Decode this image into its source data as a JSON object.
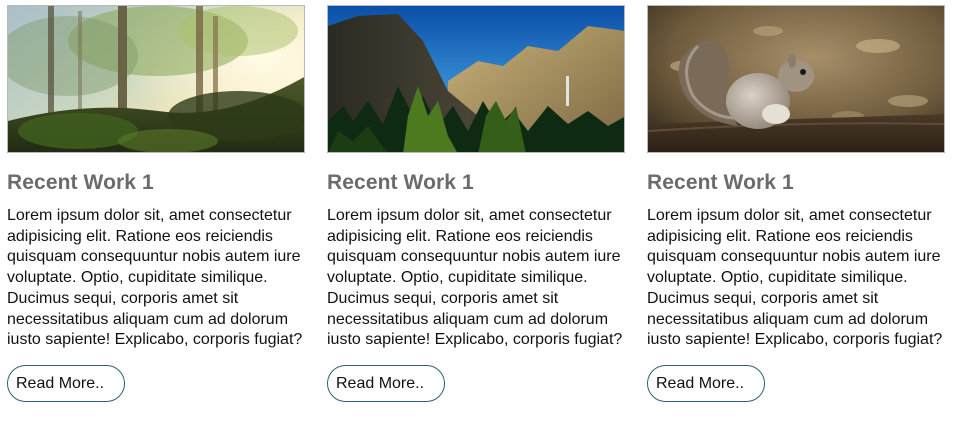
{
  "cards": [
    {
      "image": "forest-with-sunlight-image",
      "title": "Recent Work 1",
      "description": "Lorem ipsum dolor sit, amet consectetur adipisicing elit. Ratione eos reiciendis quisquam consequuntur nobis autem iure voluptate. Optio, cupiditate similique. Ducimus sequi, corporis amet sit necessitatibus aliquam cum ad dolorum iusto sapiente! Explicabo, corporis fugiat?",
      "button_label": "Read More.."
    },
    {
      "image": "mountain-valley-image",
      "title": "Recent Work 1",
      "description": "Lorem ipsum dolor sit, amet consectetur adipisicing elit. Ratione eos reiciendis quisquam consequuntur nobis autem iure voluptate. Optio, cupiditate similique. Ducimus sequi, corporis amet sit necessitatibus aliquam cum ad dolorum iusto sapiente! Explicabo, corporis fugiat?",
      "button_label": "Read More.."
    },
    {
      "image": "squirrel-image",
      "title": "Recent Work 1",
      "description": "Lorem ipsum dolor sit, amet consectetur adipisicing elit. Ratione eos reiciendis quisquam consequuntur nobis autem iure voluptate. Optio, cupiditate similique. Ducimus sequi, corporis amet sit necessitatibus aliquam cum ad dolorum iusto sapiente! Explicabo, corporis fugiat?",
      "button_label": "Read More.."
    }
  ],
  "colors": {
    "title": "#6b6b6b",
    "body_text": "#111111",
    "button_border": "#2f5f73",
    "image_border": "#b8b8b8"
  }
}
